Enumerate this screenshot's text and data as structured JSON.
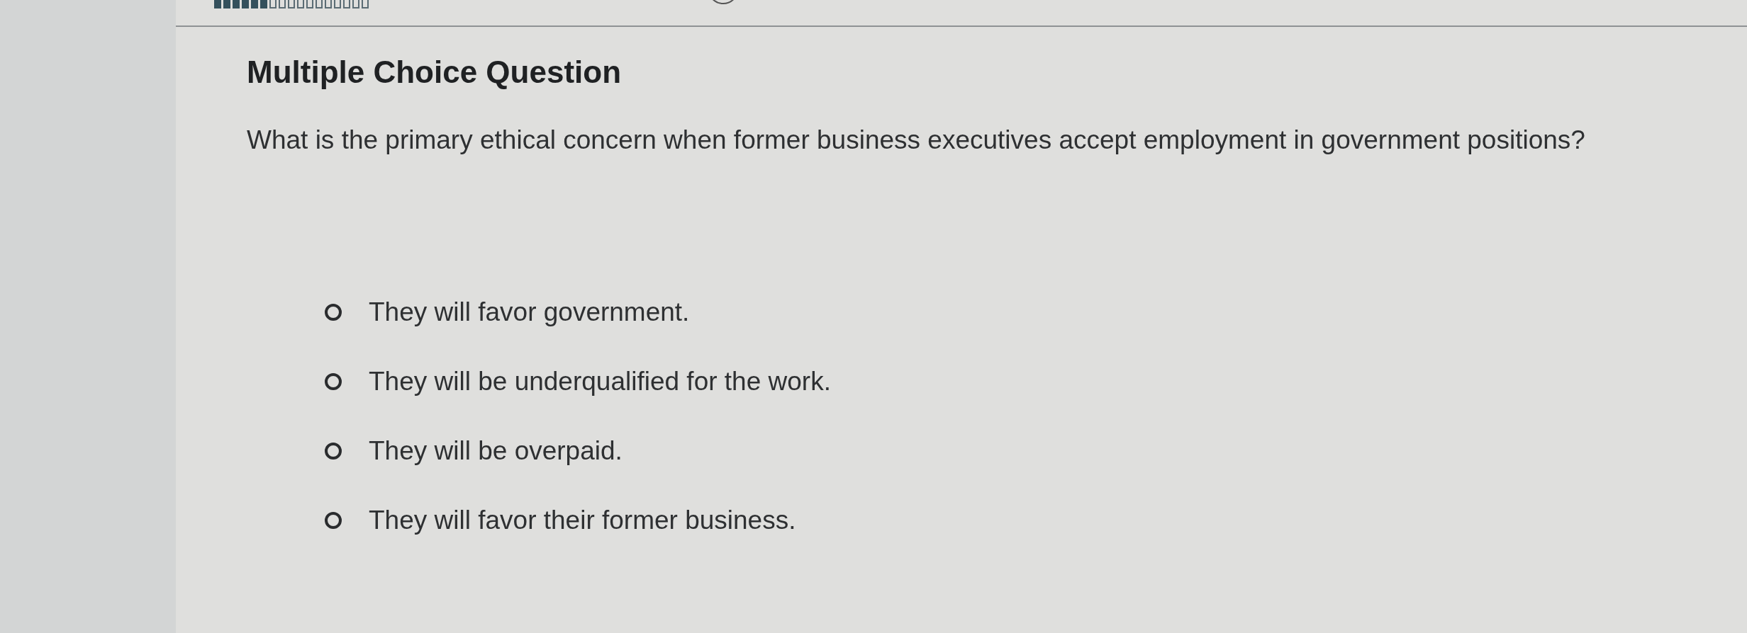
{
  "progress": {
    "level": 0.35
  },
  "question": {
    "type": "Multiple Choice Question",
    "prompt": "What is the primary ethical concern when former business executives accept employment in government positions?",
    "options": [
      {
        "label": "They will favor government.",
        "selected": false
      },
      {
        "label": "They will be underqualified for the work.",
        "selected": false
      },
      {
        "label": "They will be overpaid.",
        "selected": false
      },
      {
        "label": "They will favor their former business.",
        "selected": false
      }
    ]
  }
}
